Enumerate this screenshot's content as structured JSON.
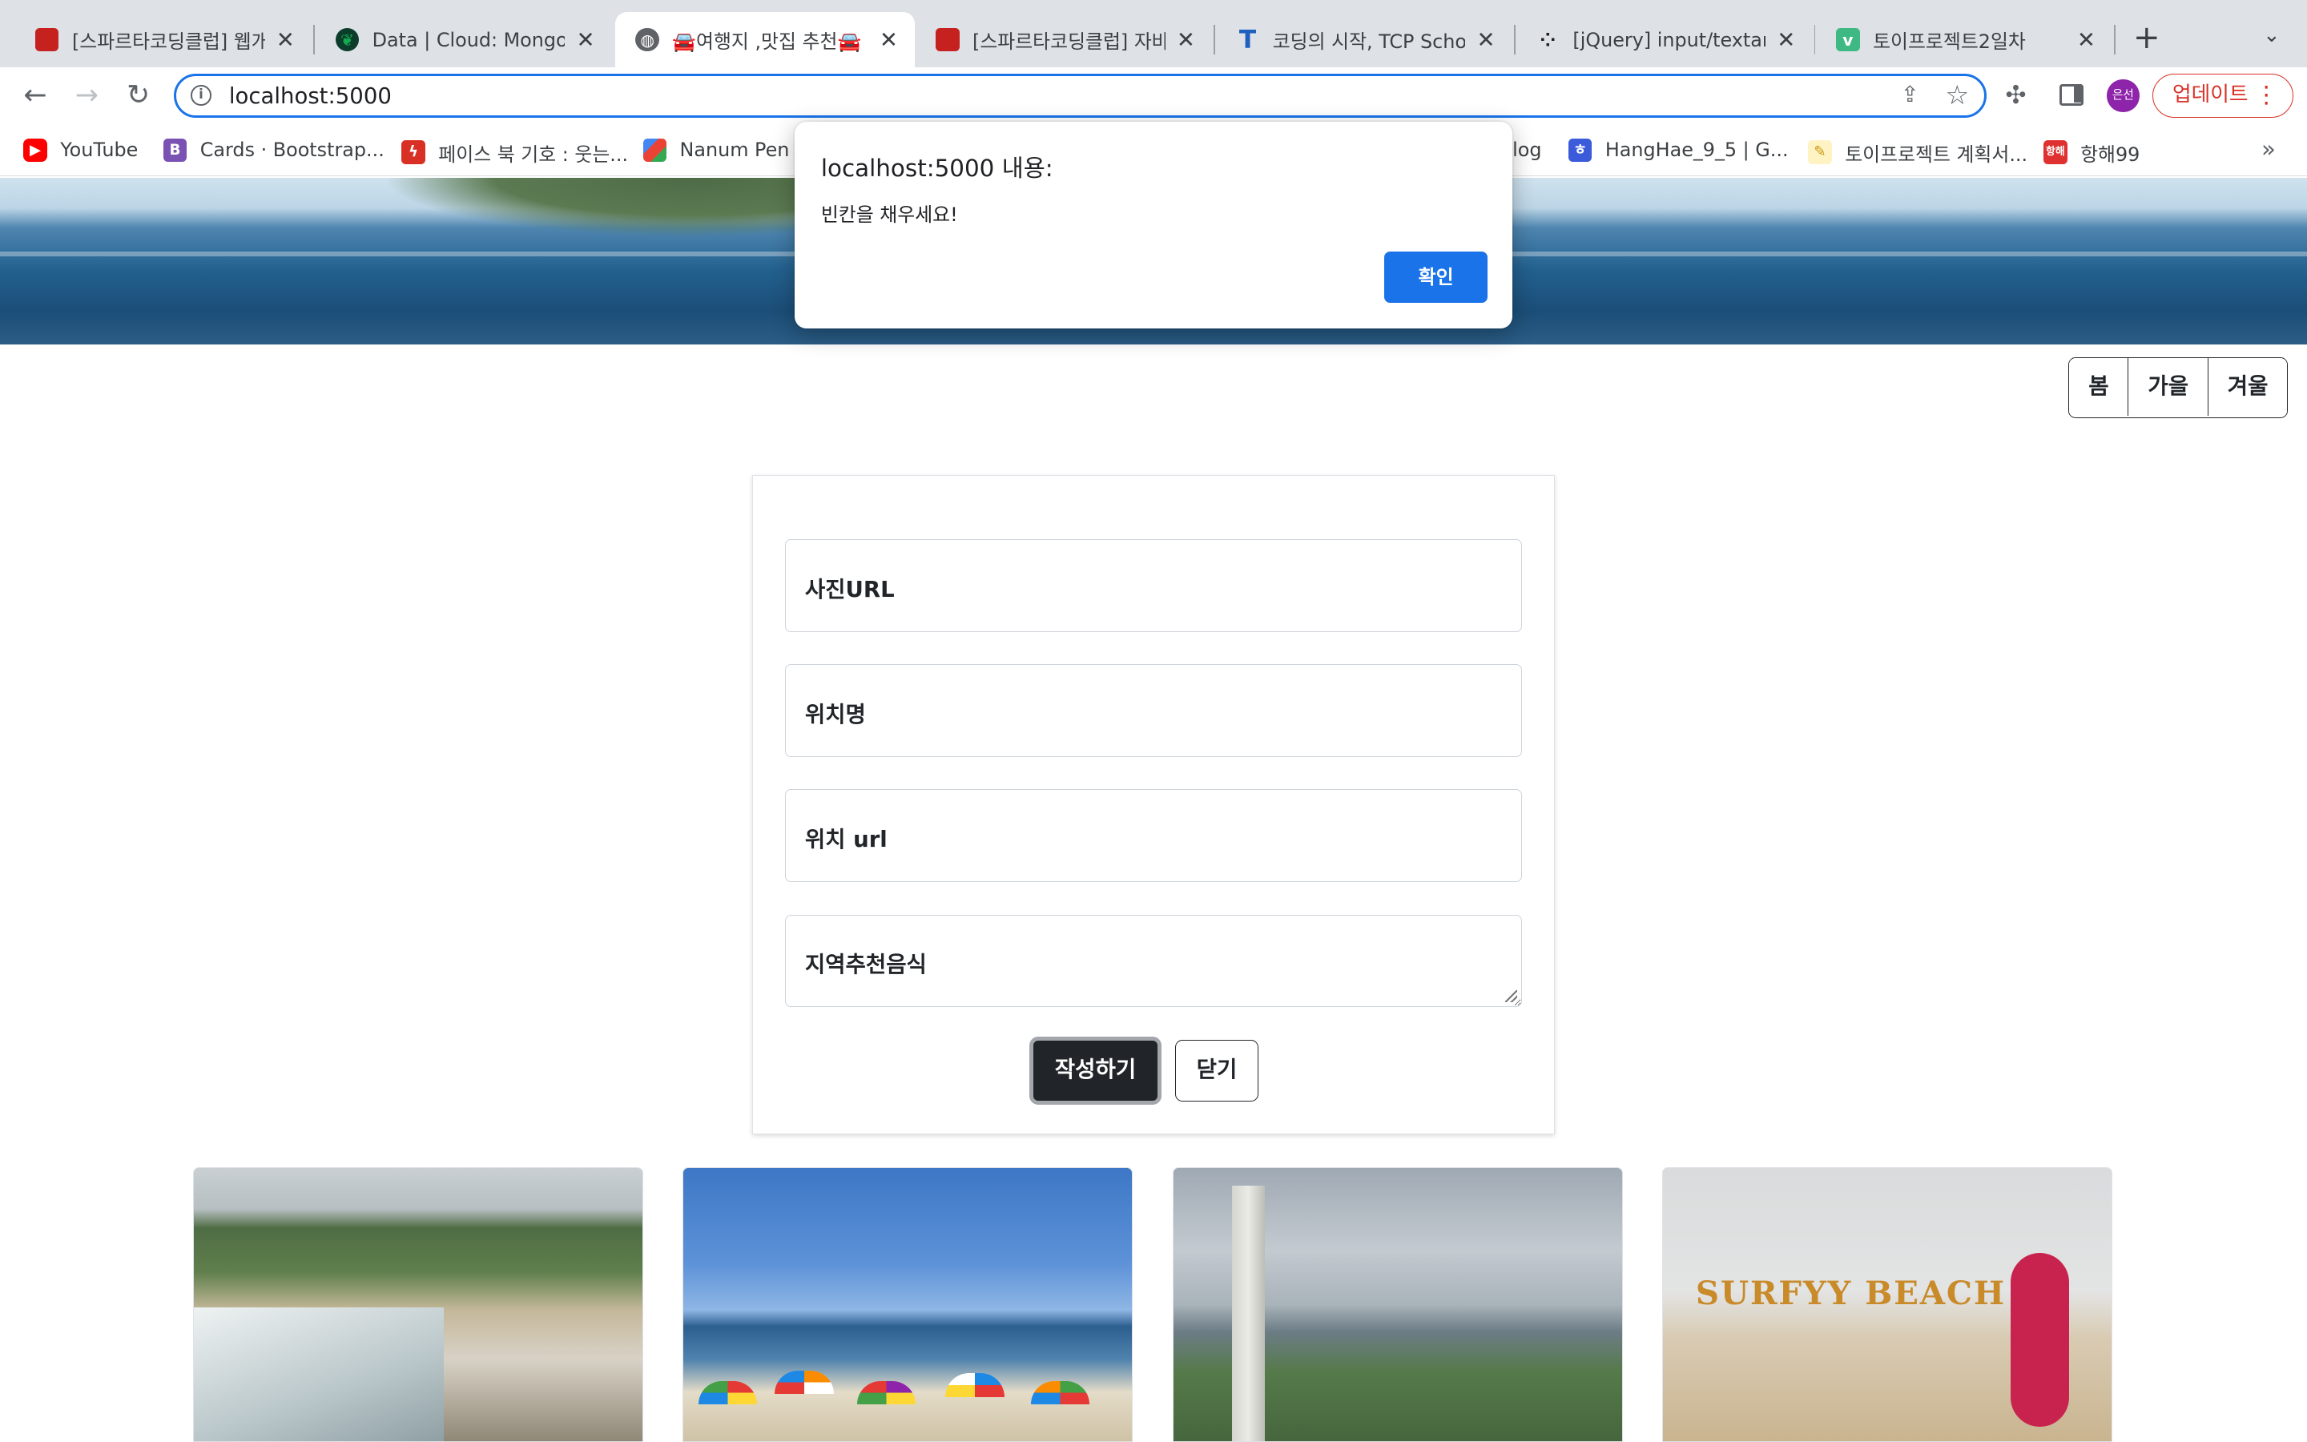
{
  "browser": {
    "tabs": [
      {
        "title": "[스파르타코딩클럽] 웹개발",
        "icon": "book-icon",
        "color": "#c5221f"
      },
      {
        "title": "Data | Cloud: MongoDB",
        "icon": "mongodb-leaf-icon",
        "color": "#13aa52"
      },
      {
        "title": "🚘여행지 ,맛집 추천🚘",
        "icon": "globe-icon",
        "color": "#5f6368",
        "active": true
      },
      {
        "title": "[스파르타코딩클럽] 자바스",
        "icon": "book-icon",
        "color": "#c5221f"
      },
      {
        "title": "코딩의 시작, TCP School",
        "icon": "tcp-school-icon",
        "color": "#1f5fbf"
      },
      {
        "title": "[jQuery] input/textarea",
        "icon": "dots-icon",
        "color": "#202124"
      },
      {
        "title": "토이프로젝트2일차",
        "icon": "vue-icon",
        "color": "#3fb984"
      }
    ],
    "url": "localhost:5000",
    "update_label": "업데이트",
    "profile_initials": "은선",
    "bookmarks": [
      {
        "label": "YouTube",
        "icon": "youtube-icon",
        "color": "#ff0000"
      },
      {
        "label": "Cards · Bootstrap...",
        "icon": "bootstrap-icon",
        "color": "#7952b3"
      },
      {
        "label": "페이스 북 기호 : 웃는...",
        "icon": "lightning-icon",
        "color": "#d93025"
      },
      {
        "label": "Nanum Pen S",
        "icon": "google-fonts-icon",
        "color": "#4285f4"
      },
      {
        "label": "log",
        "icon": "",
        "color": ""
      },
      {
        "label": "HangHae_9_5 | G...",
        "icon": "hanghae-icon",
        "color": "#3b5bdb"
      },
      {
        "label": "토이프로젝트 계획서...",
        "icon": "notion-icon",
        "color": "#f4c542"
      },
      {
        "label": "항해99",
        "icon": "hanghae99-icon",
        "color": "#e03131"
      }
    ]
  },
  "page": {
    "seasons": [
      "봄",
      "가을",
      "겨울"
    ],
    "form": {
      "photo_url_label": "사진URL",
      "location_name_label": "위치명",
      "location_url_label": "위치 url",
      "local_food_label": "지역추천음식",
      "submit_label": "작성하기",
      "close_label": "닫기"
    },
    "cards": [
      {
        "image": "crowded-beach-photo"
      },
      {
        "image": "beach-umbrellas-photo"
      },
      {
        "image": "monument-coast-photo"
      },
      {
        "image": "surfyy-beach-photo",
        "sign_text": "SURFYY BEACH"
      }
    ]
  },
  "dialog": {
    "title": "localhost:5000 내용:",
    "message": "빈칸을 채우세요!",
    "ok_label": "확인"
  }
}
